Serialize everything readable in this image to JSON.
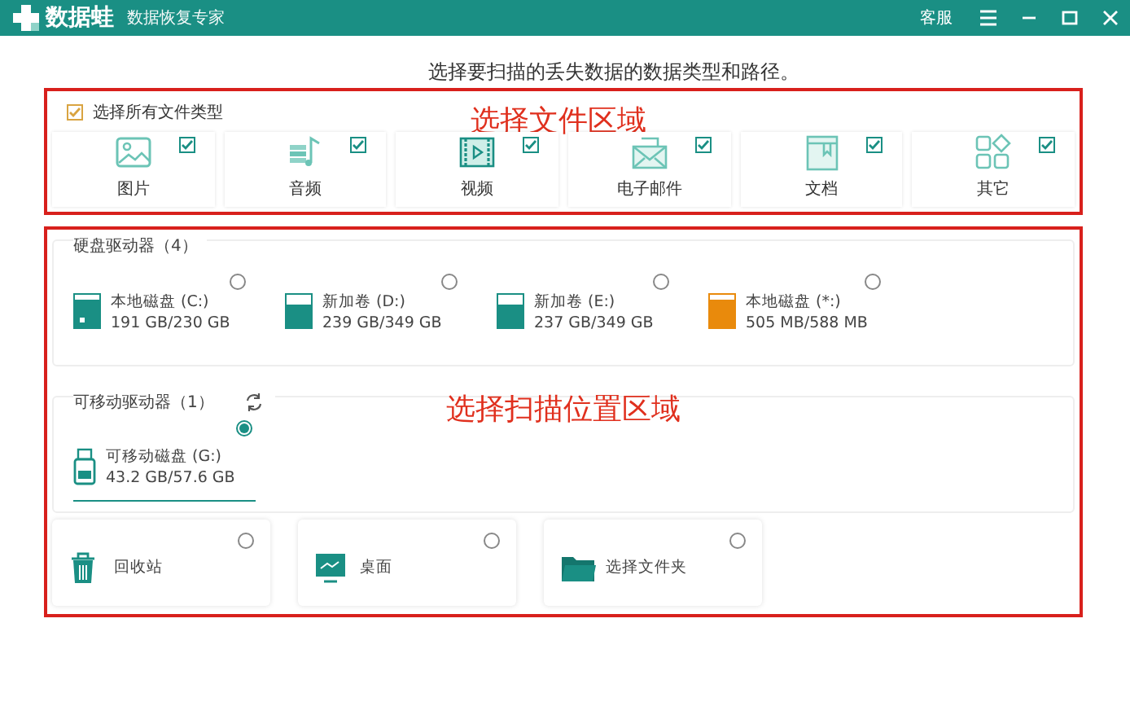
{
  "window": {
    "app_name": "数据蛙",
    "subtitle": "数据恢复专家",
    "service": "客服"
  },
  "heading": "选择要扫描的丢失数据的数据类型和路径。",
  "file_types": {
    "annotation": "选择文件区域",
    "select_all": {
      "label": "选择所有文件类型",
      "checked": true
    },
    "items": [
      {
        "kind": "image",
        "label": "图片",
        "checked": true
      },
      {
        "kind": "audio",
        "label": "音频",
        "checked": true
      },
      {
        "kind": "video",
        "label": "视频",
        "checked": true
      },
      {
        "kind": "email",
        "label": "电子邮件",
        "checked": true
      },
      {
        "kind": "document",
        "label": "文档",
        "checked": true
      },
      {
        "kind": "other",
        "label": "其它",
        "checked": true
      }
    ]
  },
  "locations": {
    "annotation": "选择扫描位置区域",
    "hard_drives": {
      "title": "硬盘驱动器（4）",
      "drives": [
        {
          "kind": "system",
          "name": "本地磁盘 (C:)",
          "usage": "191 GB/230 GB",
          "level": 0.83,
          "color": "#1a8f84",
          "selected": false
        },
        {
          "kind": "disk",
          "name": "新加卷 (D:)",
          "usage": "239 GB/349 GB",
          "level": 0.68,
          "color": "#1a8f84",
          "selected": false
        },
        {
          "kind": "disk",
          "name": "新加卷 (E:)",
          "usage": "237 GB/349 GB",
          "level": 0.68,
          "color": "#1a8f84",
          "selected": false
        },
        {
          "kind": "disk",
          "name": "本地磁盘 (*:)",
          "usage": "505 MB/588 MB",
          "level": 0.86,
          "color": "#e98a0c",
          "selected": false
        }
      ]
    },
    "removable_drives": {
      "title": "可移动驱动器（1）",
      "drives": [
        {
          "kind": "usb",
          "name": "可移动磁盘 (G:)",
          "usage": "43.2 GB/57.6 GB",
          "selected": true
        }
      ]
    },
    "shortcuts": [
      {
        "kind": "recycle",
        "label": "回收站",
        "selected": false
      },
      {
        "kind": "desktop",
        "label": "桌面",
        "selected": false
      },
      {
        "kind": "folder",
        "label": "选择文件夹",
        "selected": false
      }
    ]
  }
}
